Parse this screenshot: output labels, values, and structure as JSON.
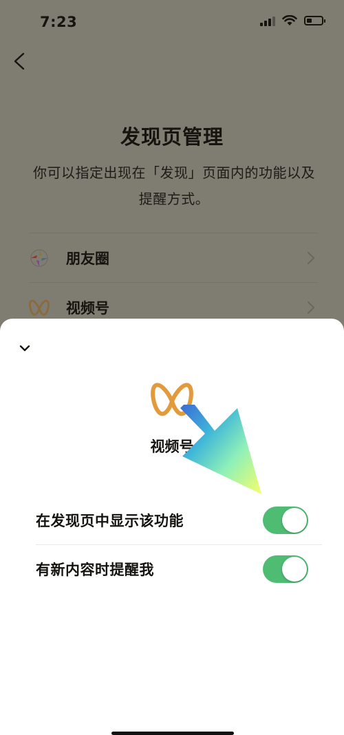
{
  "status_bar": {
    "time": "7:23",
    "battery_level": 0.35
  },
  "page": {
    "title": "发现页管理",
    "description": "你可以指定出现在「发现」页面内的功能以及提醒方式。"
  },
  "list": {
    "items": [
      {
        "label": "朋友圈",
        "icon": "moments-icon"
      },
      {
        "label": "视频号",
        "icon": "channels-icon"
      }
    ]
  },
  "sheet": {
    "title": "视频号",
    "logo_icon": "channels-icon",
    "settings": [
      {
        "label": "在发现页中显示该功能",
        "enabled": true
      },
      {
        "label": "有新内容时提醒我",
        "enabled": true
      }
    ]
  },
  "colors": {
    "dim_background": "#7f7c71",
    "toggle_on": "#4ebc73",
    "channels_orange": "#e39a3b"
  }
}
